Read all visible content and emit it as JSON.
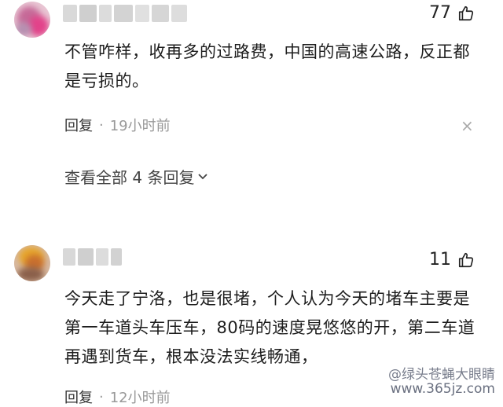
{
  "comments": [
    {
      "likes": "77",
      "text": "不管咋样，收再多的过路费，中国的高速公路，反正都是亏损的。",
      "reply_label": "回复",
      "dot": "·",
      "time": "19小时前",
      "close_glyph": "×",
      "view_all": "查看全部 4 条回复"
    },
    {
      "likes": "11",
      "text": "今天走了宁洛，也是很堵，个人认为今天的堵车主要是第一车道头车压车，80码的速度晃悠悠的开，第二车道再遇到货车，根本没法实线畅通，",
      "reply_label": "回复",
      "dot": "·",
      "time": "12小时前"
    }
  ],
  "watermark": {
    "line1": "@绿头苍蝇大眼睛",
    "line2": "www.365jz.com"
  },
  "icons": {
    "like": "thumbs-up-icon",
    "close": "close-icon",
    "expand": "chevron-down-icon"
  }
}
